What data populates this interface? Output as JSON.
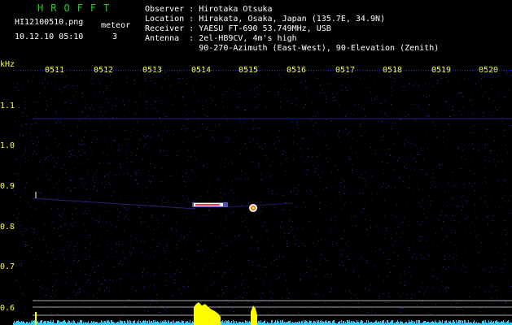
{
  "header": {
    "brand": "HROFFT",
    "filename": "HI12100510.png",
    "datetime": "10.12.10 05:10",
    "meteor_label": "meteor",
    "meteor_count": "3",
    "observer": "Observer : Hirotaka Otsuka",
    "location": "Location : Hirakata, Osaka, Japan (135.7E, 34.9N)",
    "receiver": "Receiver : YAESU FT-690 53.749MHz, USB",
    "antenna": "Antenna  : 2el-HB9CV, 4m's high",
    "antenna2": "           90-270-Azimuth (East-West), 90-Elevation (Zenith)"
  },
  "time_axis": {
    "labels": [
      "0511",
      "0512",
      "0513",
      "0514",
      "0515",
      "0516",
      "0517",
      "0518",
      "0519",
      "0520"
    ]
  },
  "freq_axis": {
    "unit": "kHz",
    "labels": [
      "1.1",
      "1.0",
      "0.9",
      "0.8",
      "0.7",
      "0.6"
    ]
  },
  "colors": {
    "background": "#000000",
    "noise": "#1a1a8a",
    "text": "#ffffff",
    "axis_text": "#ffff33",
    "brand": "#22cc22",
    "meteor_core": "#ff3333",
    "meteor_halo": "#ffffff",
    "bar_peak": "#ffff00",
    "bar_floor": "#33ccff"
  }
}
